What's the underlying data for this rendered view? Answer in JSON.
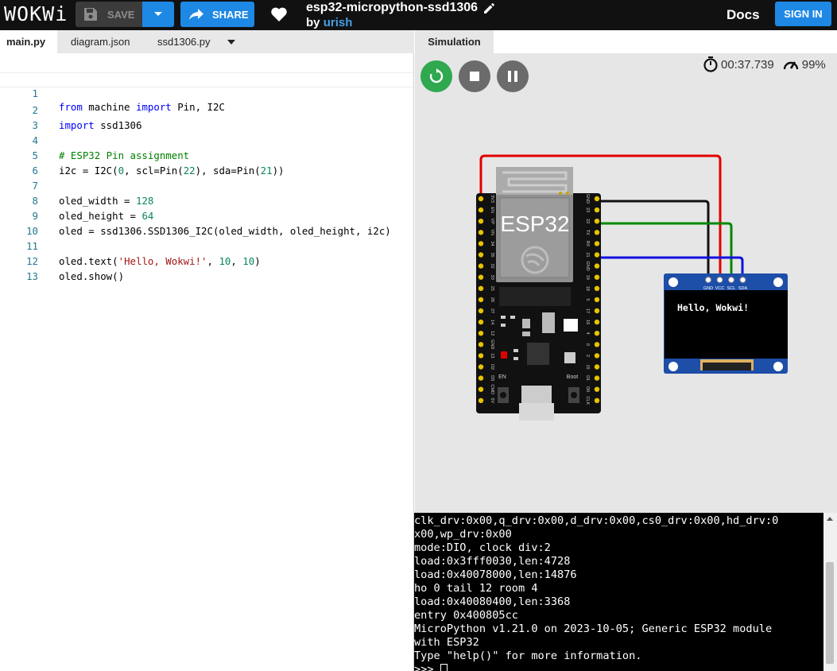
{
  "app": {
    "logo": "WOKWi",
    "save_label": "SAVE",
    "share_label": "SHARE",
    "project_title": "esp32-micropython-ssd1306",
    "by_label": "by",
    "author": "urish",
    "docs_label": "Docs",
    "signin_label": "SIGN IN"
  },
  "editor": {
    "tabs": [
      {
        "label": "main.py",
        "active": true
      },
      {
        "label": "diagram.json",
        "active": false
      },
      {
        "label": "ssd1306.py",
        "active": false
      }
    ],
    "lines": [
      "1",
      "2",
      "3",
      "4",
      "5",
      "6",
      "7",
      "8",
      "9",
      "10",
      "11",
      "12",
      "13"
    ],
    "code": {
      "l1": "from machine import Pin, I2C",
      "l2": "import ssd1306",
      "l4": "# ESP32 Pin assignment",
      "l5": "i2c = I2C(0, scl=Pin(22), sda=Pin(21))",
      "l7": "oled_width = 128",
      "l8": "oled_height = 64",
      "l9": "oled = ssd1306.SSD1306_I2C(oled_width, oled_height, i2c)",
      "l11": "oled.text('Hello, Wokwi!', 10, 10)",
      "l12": "oled.show()"
    }
  },
  "simulation": {
    "tab_label": "Simulation",
    "timer": "00:37.739",
    "speed": "99%",
    "esp32_label": "ESP32",
    "oled_text": "Hello, Wokwi!",
    "oled_pins": [
      "GND",
      "VCC",
      "SCL",
      "SDA"
    ],
    "left_pins": [
      "3V3",
      "EN",
      "VP",
      "VN",
      "34",
      "35",
      "32",
      "33",
      "25",
      "26",
      "27",
      "14",
      "12",
      "GND",
      "13",
      "D2",
      "D3",
      "CMD",
      "5V"
    ],
    "right_pins": [
      "GND",
      "23",
      "22",
      "TX",
      "RX",
      "21",
      "GND",
      "19",
      "18",
      "5",
      "17",
      "16",
      "4",
      "0",
      "2",
      "15",
      "D1",
      "D0",
      "CLK"
    ],
    "en_label": "EN",
    "boot_label": "Boot",
    "colors": {
      "red": "#e00000",
      "black": "#111111",
      "green": "#008800",
      "blue": "#1010e0"
    }
  },
  "terminal": {
    "lines": [
      "clk_drv:0x00,q_drv:0x00,d_drv:0x00,cs0_drv:0x00,hd_drv:0",
      "x00,wp_drv:0x00",
      "mode:DIO, clock div:2",
      "load:0x3fff0030,len:4728",
      "load:0x40078000,len:14876",
      "ho 0 tail 12 room 4",
      "load:0x40080400,len:3368",
      "entry 0x400805cc",
      "MicroPython v1.21.0 on 2023-10-05; Generic ESP32 module",
      "with ESP32",
      "Type \"help()\" for more information."
    ],
    "prompt": ">>> "
  }
}
